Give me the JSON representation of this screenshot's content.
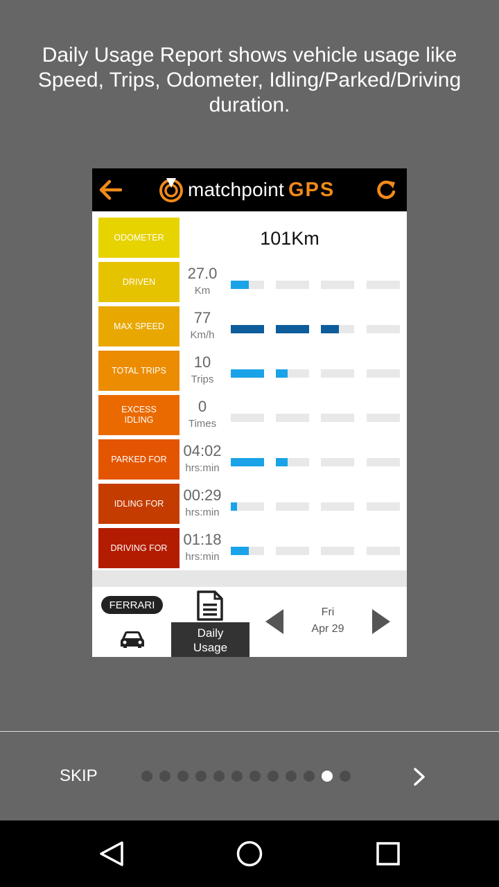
{
  "description": "Daily Usage Report shows vehicle usage like Speed, Trips, Odometer, Idling/Parked/Driving duration.",
  "app": {
    "logo_name": "matchpoint",
    "logo_gps": "GPS",
    "back_icon": "arrow-left-icon",
    "refresh_icon": "refresh-icon",
    "accent_color": "#f08a1c"
  },
  "odometer": {
    "label": "ODOMETER",
    "value": "101Km",
    "color": "#e6d300"
  },
  "metrics": [
    {
      "label": "DRIVEN",
      "value": "27.0",
      "unit": "Km",
      "color": "#e6c300",
      "bars": [
        0.55,
        0,
        0,
        0
      ],
      "bar_color": "#1aa3e8"
    },
    {
      "label": "MAX SPEED",
      "value": "77",
      "unit": "Km/h",
      "color": "#e8a800",
      "bars": [
        1,
        1,
        0.55,
        0
      ],
      "bar_color": "#0d5c9c"
    },
    {
      "label": "TOTAL TRIPS",
      "value": "10",
      "unit": "Trips",
      "color": "#ec8c00",
      "bars": [
        1,
        0.35,
        0,
        0
      ],
      "bar_color": "#1aa3e8"
    },
    {
      "label": "EXCESS\nIDLING",
      "value": "0",
      "unit": "Times",
      "color": "#ea6a00",
      "bars": [
        0,
        0,
        0,
        0
      ],
      "bar_color": "#1aa3e8"
    },
    {
      "label": "PARKED FOR",
      "value": "04:02",
      "unit": "hrs:min",
      "color": "#e35500",
      "bars": [
        1,
        0.35,
        0,
        0
      ],
      "bar_color": "#1aa3e8"
    },
    {
      "label": "IDLING FOR",
      "value": "00:29",
      "unit": "hrs:min",
      "color": "#c43c00",
      "bars": [
        0.18,
        0,
        0,
        0
      ],
      "bar_color": "#1aa3e8"
    },
    {
      "label": "DRIVING FOR",
      "value": "01:18",
      "unit": "hrs:min",
      "color": "#b31c00",
      "bars": [
        0.55,
        0,
        0,
        0
      ],
      "bar_color": "#1aa3e8"
    }
  ],
  "bottom": {
    "vehicle": "FERRARI",
    "vehicle_icon": "car-icon",
    "tab_label": "Daily\nUsage",
    "tab_icon": "document-icon",
    "day": "Fri",
    "date": "Apr 29"
  },
  "onboarding": {
    "skip_label": "SKIP",
    "page_count": 12,
    "active_page": 11,
    "next_icon": "chevron-right-icon"
  },
  "system_nav": {
    "back_icon": "nav-back-icon",
    "home_icon": "nav-home-icon",
    "recent_icon": "nav-recent-icon"
  }
}
